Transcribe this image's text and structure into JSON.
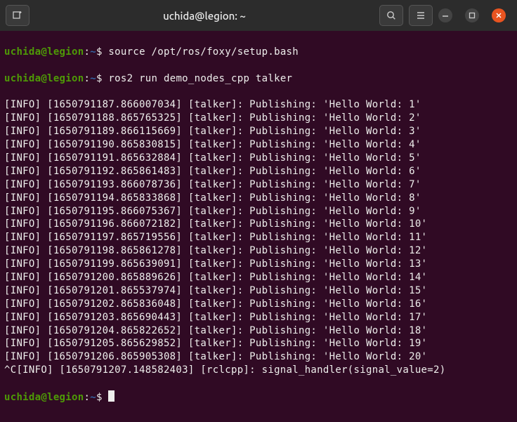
{
  "titlebar": {
    "title": "uchida@legion: ~"
  },
  "prompt": {
    "user_host": "uchida@legion",
    "sep1": ":",
    "path": "~",
    "sigil": "$"
  },
  "commands": {
    "cmd1": "source /opt/ros/foxy/setup.bash",
    "cmd2": "ros2 run demo_nodes_cpp talker"
  },
  "log_lines": [
    "[INFO] [1650791187.866007034] [talker]: Publishing: 'Hello World: 1'",
    "[INFO] [1650791188.865765325] [talker]: Publishing: 'Hello World: 2'",
    "[INFO] [1650791189.866115669] [talker]: Publishing: 'Hello World: 3'",
    "[INFO] [1650791190.865830815] [talker]: Publishing: 'Hello World: 4'",
    "[INFO] [1650791191.865632884] [talker]: Publishing: 'Hello World: 5'",
    "[INFO] [1650791192.865861483] [talker]: Publishing: 'Hello World: 6'",
    "[INFO] [1650791193.866078736] [talker]: Publishing: 'Hello World: 7'",
    "[INFO] [1650791194.865833868] [talker]: Publishing: 'Hello World: 8'",
    "[INFO] [1650791195.866075367] [talker]: Publishing: 'Hello World: 9'",
    "[INFO] [1650791196.866072182] [talker]: Publishing: 'Hello World: 10'",
    "[INFO] [1650791197.865719556] [talker]: Publishing: 'Hello World: 11'",
    "[INFO] [1650791198.865861278] [talker]: Publishing: 'Hello World: 12'",
    "[INFO] [1650791199.865639091] [talker]: Publishing: 'Hello World: 13'",
    "[INFO] [1650791200.865889626] [talker]: Publishing: 'Hello World: 14'",
    "[INFO] [1650791201.865537974] [talker]: Publishing: 'Hello World: 15'",
    "[INFO] [1650791202.865836048] [talker]: Publishing: 'Hello World: 16'",
    "[INFO] [1650791203.865690443] [talker]: Publishing: 'Hello World: 17'",
    "[INFO] [1650791204.865822652] [talker]: Publishing: 'Hello World: 18'",
    "[INFO] [1650791205.865629852] [talker]: Publishing: 'Hello World: 19'",
    "[INFO] [1650791206.865905308] [talker]: Publishing: 'Hello World: 20'",
    "^C[INFO] [1650791207.148582403] [rclcpp]: signal_handler(signal_value=2)"
  ]
}
